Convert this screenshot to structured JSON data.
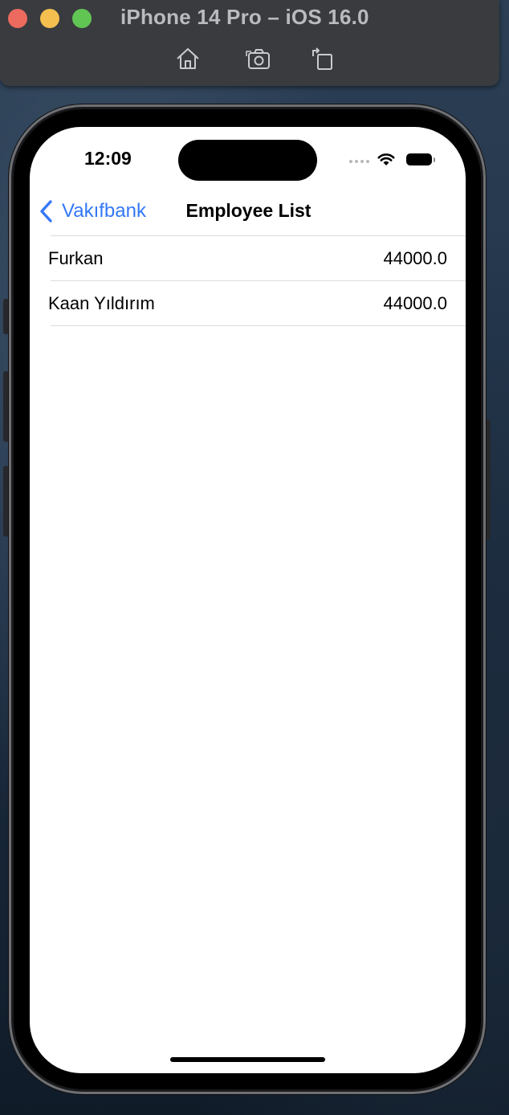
{
  "window": {
    "title": "iPhone 14 Pro – iOS 16.0",
    "toolbar_icons": [
      "home-icon",
      "screenshot-icon",
      "rotate-icon"
    ]
  },
  "status_bar": {
    "time": "12:09",
    "icons": [
      "signal-dots-icon",
      "wifi-icon",
      "battery-icon"
    ]
  },
  "nav": {
    "back_label": "Vakıfbank",
    "title": "Employee List",
    "accent_color": "#3478f6"
  },
  "employees": [
    {
      "name": "Furkan",
      "salary": "44000.0"
    },
    {
      "name": "Kaan Yıldırım",
      "salary": "44000.0"
    }
  ]
}
